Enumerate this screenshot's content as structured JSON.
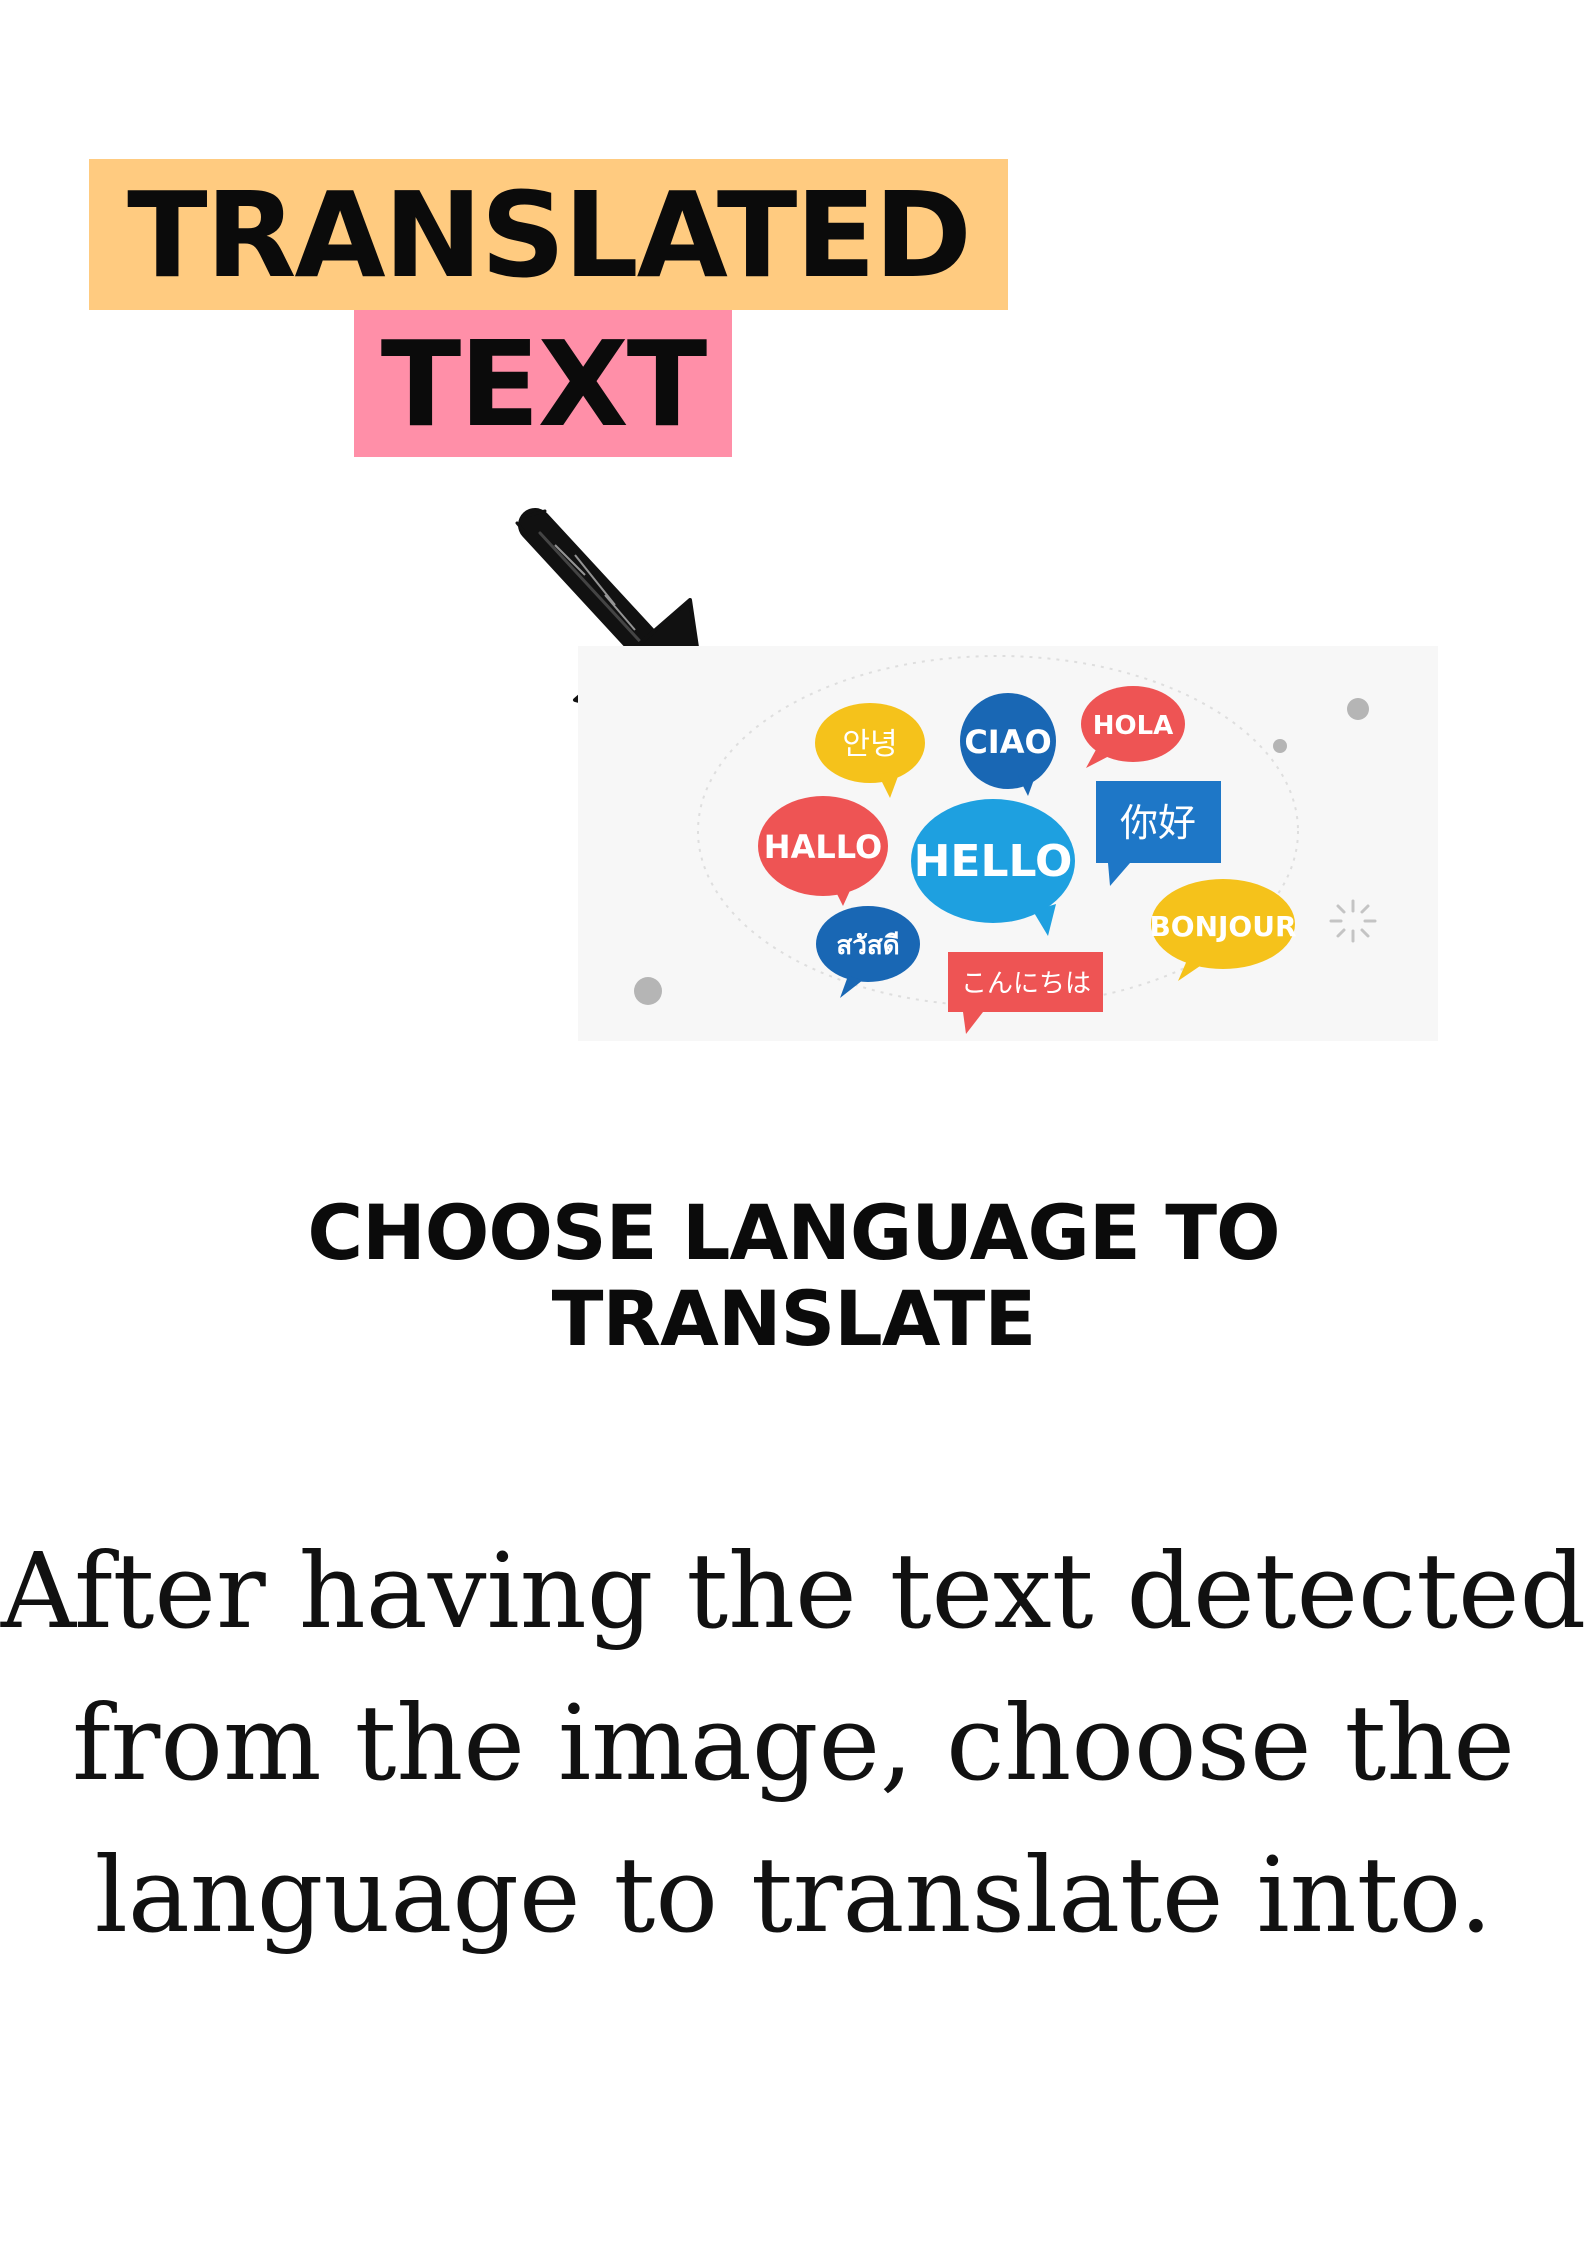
{
  "title": {
    "line1": "TRANSLATED",
    "line2": "TEXT"
  },
  "colors": {
    "title_line1_bg": "#ffcb80",
    "title_line2_bg": "#ff8fa8",
    "text": "#0b0b0b"
  },
  "illustration": {
    "icon": "speech-bubbles-greetings",
    "bubbles": [
      "안녕",
      "CIAO",
      "HOLA",
      "HALLO",
      "HELLO",
      "你好",
      "สวัสดี",
      "BONJOUR",
      "こんにちは"
    ]
  },
  "heading": {
    "line1": "CHOOSE LANGUAGE TO",
    "line2": "TRANSLATE"
  },
  "body": {
    "line1": "After having the text detected",
    "line2": "from the image, choose the",
    "line3": "language to translate into."
  }
}
